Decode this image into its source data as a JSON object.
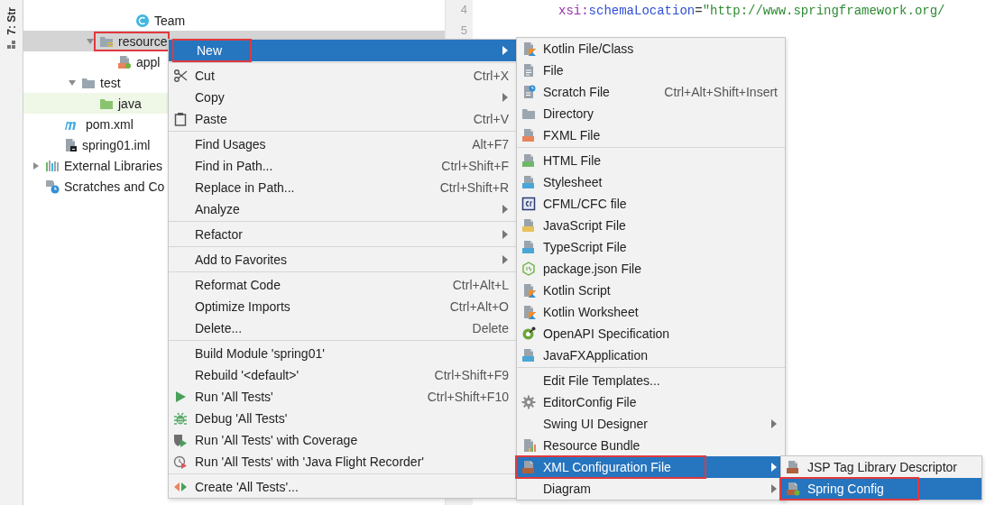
{
  "side_stripe": {
    "label": "7: Str"
  },
  "project_tree": {
    "items": [
      {
        "label": "Team",
        "selected": false,
        "tinted": false,
        "highlighted": false
      },
      {
        "label": "resource",
        "expanded": true,
        "selected": true,
        "tinted": false,
        "highlighted": true,
        "children": [
          {
            "label": "appl",
            "selected": false,
            "tinted": false,
            "highlighted": false
          }
        ]
      },
      {
        "label": "test",
        "expanded": true,
        "selected": false,
        "tinted": false,
        "highlighted": false,
        "children": [
          {
            "label": "java",
            "selected": false,
            "tinted": true,
            "highlighted": false
          }
        ]
      },
      {
        "label": "pom.xml",
        "selected": false,
        "tinted": false,
        "highlighted": false
      },
      {
        "label": "spring01.iml",
        "selected": false,
        "tinted": false,
        "highlighted": false
      },
      {
        "label": "External Libraries",
        "expanded": false,
        "selected": false,
        "tinted": false,
        "highlighted": false
      },
      {
        "label": "Scratches and Co",
        "selected": false,
        "tinted": false,
        "highlighted": false
      }
    ]
  },
  "editor": {
    "line_numbers": [
      "4",
      "5"
    ],
    "code_tokens": [
      {
        "kind": "prefix",
        "text": "xsi:"
      },
      {
        "kind": "attribute",
        "text": "schemaLocation"
      },
      {
        "kind": "plain",
        "text": "="
      },
      {
        "kind": "string",
        "text": "\"http://www.springframework.org/"
      }
    ]
  },
  "context_menu": {
    "groups": [
      [
        {
          "label": "New",
          "submenu": true,
          "selected": true,
          "highlighted": true
        }
      ],
      [
        {
          "label": "Cut",
          "shortcut": "Ctrl+X",
          "submenu": false,
          "selected": false,
          "highlighted": false
        },
        {
          "label": "Copy",
          "submenu": true,
          "selected": false,
          "highlighted": false
        },
        {
          "label": "Paste",
          "shortcut": "Ctrl+V",
          "submenu": false,
          "selected": false,
          "highlighted": false
        }
      ],
      [
        {
          "label": "Find Usages",
          "shortcut": "Alt+F7",
          "submenu": false,
          "selected": false,
          "highlighted": false
        },
        {
          "label": "Find in Path...",
          "shortcut": "Ctrl+Shift+F",
          "submenu": false,
          "selected": false,
          "highlighted": false
        },
        {
          "label": "Replace in Path...",
          "shortcut": "Ctrl+Shift+R",
          "submenu": false,
          "selected": false,
          "highlighted": false
        },
        {
          "label": "Analyze",
          "submenu": true,
          "selected": false,
          "highlighted": false
        }
      ],
      [
        {
          "label": "Refactor",
          "submenu": true,
          "selected": false,
          "highlighted": false
        }
      ],
      [
        {
          "label": "Add to Favorites",
          "submenu": true,
          "selected": false,
          "highlighted": false
        }
      ],
      [
        {
          "label": "Reformat Code",
          "shortcut": "Ctrl+Alt+L",
          "submenu": false,
          "selected": false,
          "highlighted": false
        },
        {
          "label": "Optimize Imports",
          "shortcut": "Ctrl+Alt+O",
          "submenu": false,
          "selected": false,
          "highlighted": false
        },
        {
          "label": "Delete...",
          "shortcut": "Delete",
          "submenu": false,
          "selected": false,
          "highlighted": false
        }
      ],
      [
        {
          "label": "Build Module 'spring01'",
          "submenu": false,
          "selected": false,
          "highlighted": false
        },
        {
          "label": "Rebuild '<default>'",
          "shortcut": "Ctrl+Shift+F9",
          "submenu": false,
          "selected": false,
          "highlighted": false
        },
        {
          "label": "Run 'All Tests'",
          "shortcut": "Ctrl+Shift+F10",
          "submenu": false,
          "selected": false,
          "highlighted": false
        },
        {
          "label": "Debug 'All Tests'",
          "submenu": false,
          "selected": false,
          "highlighted": false
        },
        {
          "label": "Run 'All Tests' with Coverage",
          "submenu": false,
          "selected": false,
          "highlighted": false
        },
        {
          "label": "Run 'All Tests' with 'Java Flight Recorder'",
          "submenu": false,
          "selected": false,
          "highlighted": false
        }
      ],
      [
        {
          "label": "Create 'All Tests'...",
          "submenu": false,
          "selected": false,
          "highlighted": false
        }
      ]
    ]
  },
  "new_submenu": {
    "groups": [
      [
        {
          "label": "Kotlin File/Class",
          "submenu": false,
          "selected": false,
          "highlighted": false
        },
        {
          "label": "File",
          "submenu": false,
          "selected": false,
          "highlighted": false
        },
        {
          "label": "Scratch File",
          "shortcut": "Ctrl+Alt+Shift+Insert",
          "submenu": false,
          "selected": false,
          "highlighted": false
        },
        {
          "label": "Directory",
          "submenu": false,
          "selected": false,
          "highlighted": false
        },
        {
          "label": "FXML File",
          "submenu": false,
          "selected": false,
          "highlighted": false
        }
      ],
      [
        {
          "label": "HTML File",
          "submenu": false,
          "selected": false,
          "highlighted": false
        },
        {
          "label": "Stylesheet",
          "submenu": false,
          "selected": false,
          "highlighted": false
        },
        {
          "label": "CFML/CFC file",
          "submenu": false,
          "selected": false,
          "highlighted": false
        },
        {
          "label": "JavaScript File",
          "submenu": false,
          "selected": false,
          "highlighted": false
        },
        {
          "label": "TypeScript File",
          "submenu": false,
          "selected": false,
          "highlighted": false
        },
        {
          "label": "package.json File",
          "submenu": false,
          "selected": false,
          "highlighted": false
        },
        {
          "label": "Kotlin Script",
          "submenu": false,
          "selected": false,
          "highlighted": false
        },
        {
          "label": "Kotlin Worksheet",
          "submenu": false,
          "selected": false,
          "highlighted": false
        },
        {
          "label": "OpenAPI Specification",
          "submenu": false,
          "selected": false,
          "highlighted": false
        },
        {
          "label": "JavaFXApplication",
          "submenu": false,
          "selected": false,
          "highlighted": false
        }
      ],
      [
        {
          "label": "Edit File Templates...",
          "submenu": false,
          "selected": false,
          "highlighted": false
        },
        {
          "label": "EditorConfig File",
          "submenu": false,
          "selected": false,
          "highlighted": false
        },
        {
          "label": "Swing UI Designer",
          "submenu": true,
          "selected": false,
          "highlighted": false
        },
        {
          "label": "Resource Bundle",
          "submenu": false,
          "selected": false,
          "highlighted": false
        },
        {
          "label": "XML Configuration File",
          "submenu": true,
          "selected": true,
          "highlighted": true
        },
        {
          "label": "Diagram",
          "submenu": true,
          "selected": false,
          "highlighted": false
        }
      ]
    ]
  },
  "xml_submenu": {
    "groups": [
      [
        {
          "label": "JSP Tag Library Descriptor",
          "submenu": false,
          "selected": false,
          "highlighted": false
        },
        {
          "label": "Spring Config",
          "submenu": false,
          "selected": true,
          "highlighted": true
        }
      ]
    ]
  }
}
